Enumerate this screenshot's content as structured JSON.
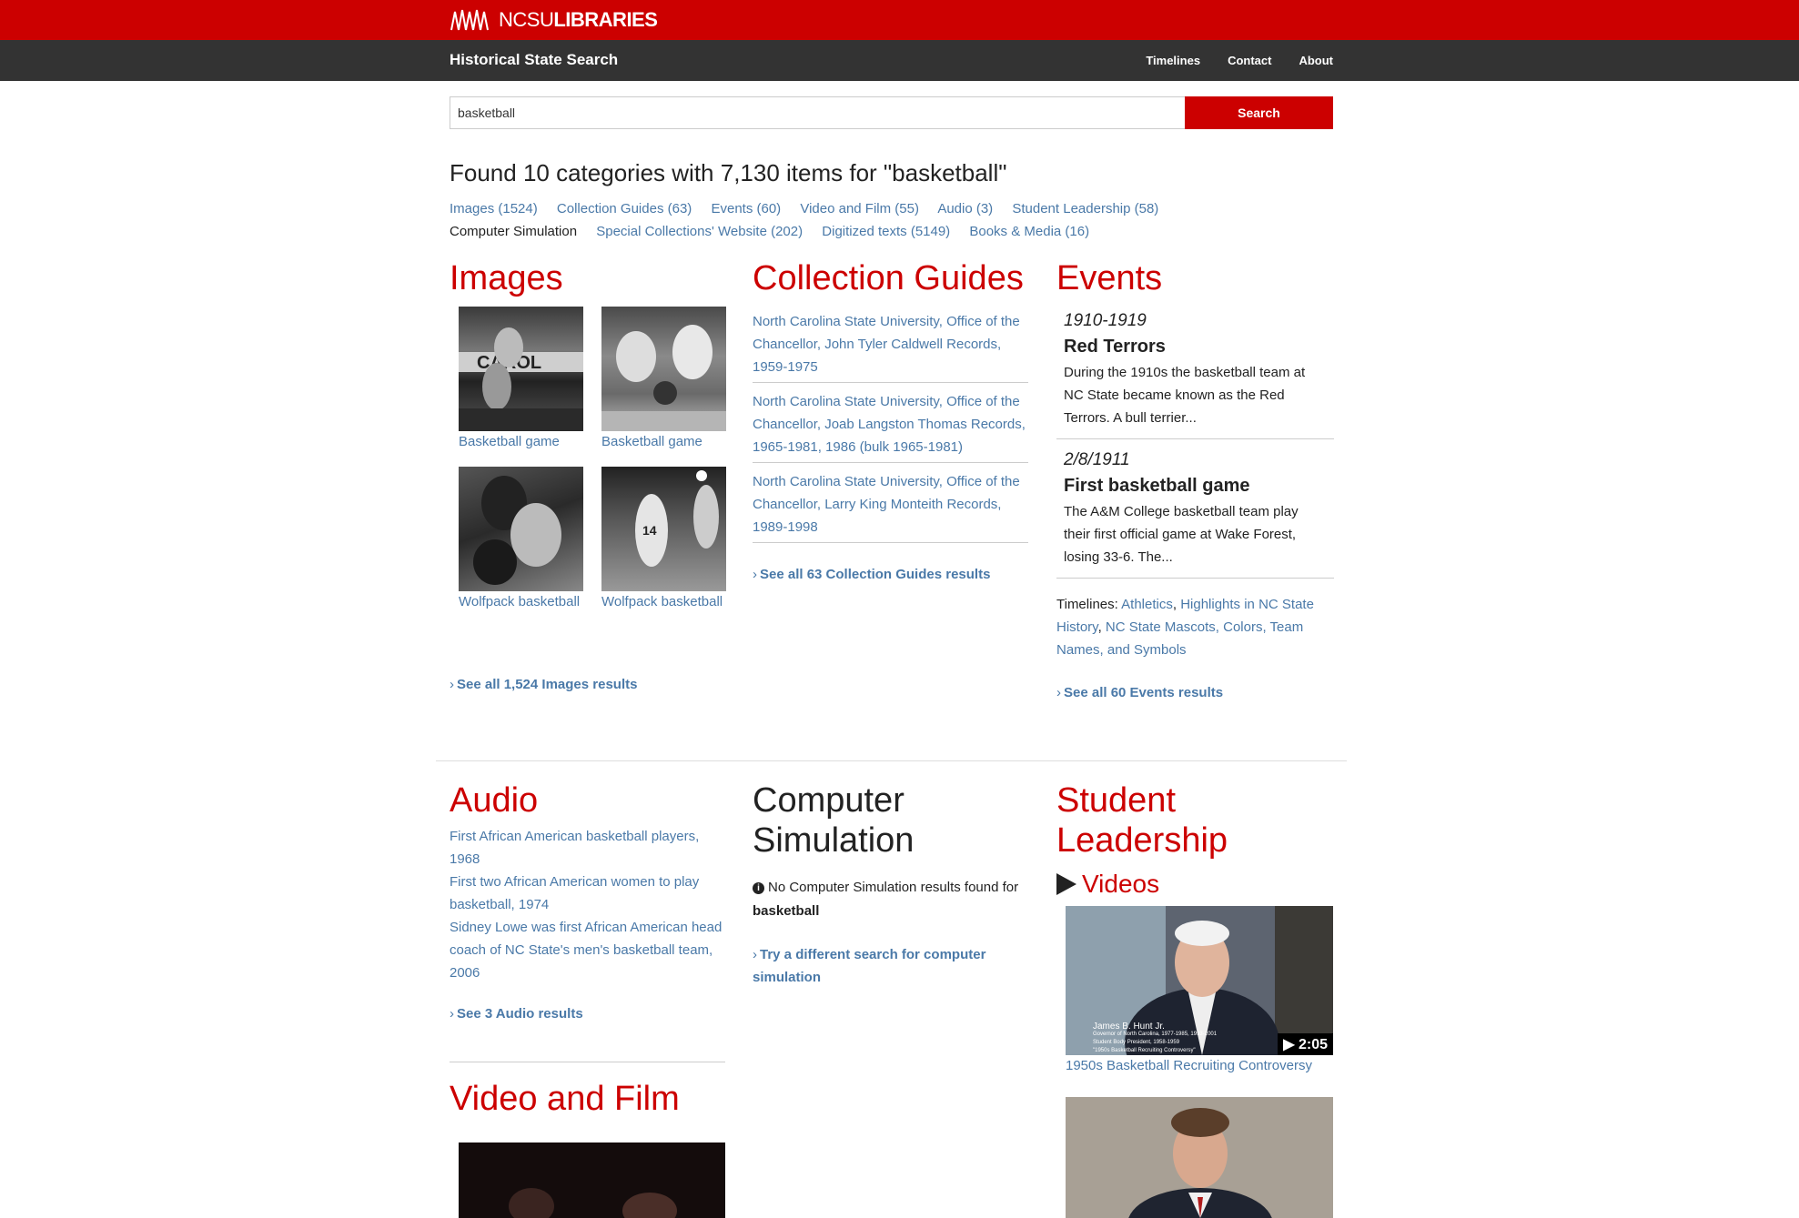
{
  "header": {
    "logo_text_prefix": "NCSU",
    "logo_text_bold": "LIBRARIES",
    "brand": "Historical State Search",
    "nav": [
      "Timelines",
      "Contact",
      "About"
    ]
  },
  "search": {
    "value": "basketball",
    "button_label": "Search"
  },
  "results": {
    "heading": "Found 10 categories with 7,130 items for \"basketball\"",
    "categories": [
      "Images (1524)",
      "Collection Guides (63)",
      "Events (60)",
      "Video and Film (55)",
      "Audio (3)",
      "Student Leadership (58)",
      "Computer Simulation",
      "Special Collections' Website (202)",
      "Digitized texts (5149)",
      "Books & Media (16)"
    ]
  },
  "images": {
    "title": "Images",
    "items": [
      {
        "caption": "Basketball game"
      },
      {
        "caption": "Basketball game"
      },
      {
        "caption": "Wolfpack basketball"
      },
      {
        "caption": "Wolfpack basketball"
      }
    ],
    "see_all": "See all 1,524 Images results"
  },
  "guides": {
    "title": "Collection Guides",
    "items": [
      "North Carolina State University, Office of the Chancellor, John Tyler Caldwell Records, 1959-1975",
      "North Carolina State University, Office of the Chancellor, Joab Langston Thomas Records, 1965-1981, 1986 (bulk 1965-1981)",
      "North Carolina State University, Office of the Chancellor, Larry King Monteith Records, 1989-1998"
    ],
    "see_all": "See all 63 Collection Guides results"
  },
  "events": {
    "title": "Events",
    "items": [
      {
        "date": "1910-1919",
        "title": "Red Terrors",
        "text": "During the 1910s the basketball team at NC State became known as the Red Terrors. A bull terrier..."
      },
      {
        "date": "2/8/1911",
        "title": "First basketball game",
        "text": "The A&M College basketball team play their first official game at Wake Forest, losing 33-6. The..."
      }
    ],
    "timelines_label": "Timelines:",
    "timelines": [
      "Athletics",
      "Highlights in NC State History",
      "NC State Mascots, Colors, Team Names, and Symbols"
    ],
    "see_all": "See all 60 Events results"
  },
  "audio": {
    "title": "Audio",
    "items": [
      "First African American basketball players, 1968",
      "First two African American women to play basketball, 1974",
      "Sidney Lowe was first African American head coach of NC State's men's basketball team, 2006"
    ],
    "see_all": "See 3 Audio results"
  },
  "simulation": {
    "title": "Computer Simulation",
    "no_results": "No Computer Simulation results found for",
    "query": "basketball",
    "try_link": "Try a different search for computer simulation"
  },
  "leadership": {
    "title": "Student Leadership",
    "videos_label": "Videos",
    "video1_caption": "1950s Basketball Recruiting Controversy",
    "video1_duration": "2:05",
    "video1_overlay_name": "James B. Hunt Jr.",
    "video1_overlay_line1": "Governor of North Carolina, 1977-1985, 1993-2001",
    "video1_overlay_line2": "Student Body President, 1958-1959",
    "video1_overlay_line3": "\"1950s Basketball Recruiting Controversy\""
  },
  "video_film": {
    "title": "Video and Film"
  },
  "colors": {
    "brand_red": "#cc0000",
    "nav_dark": "#333333",
    "link_blue": "#4a79a8"
  }
}
